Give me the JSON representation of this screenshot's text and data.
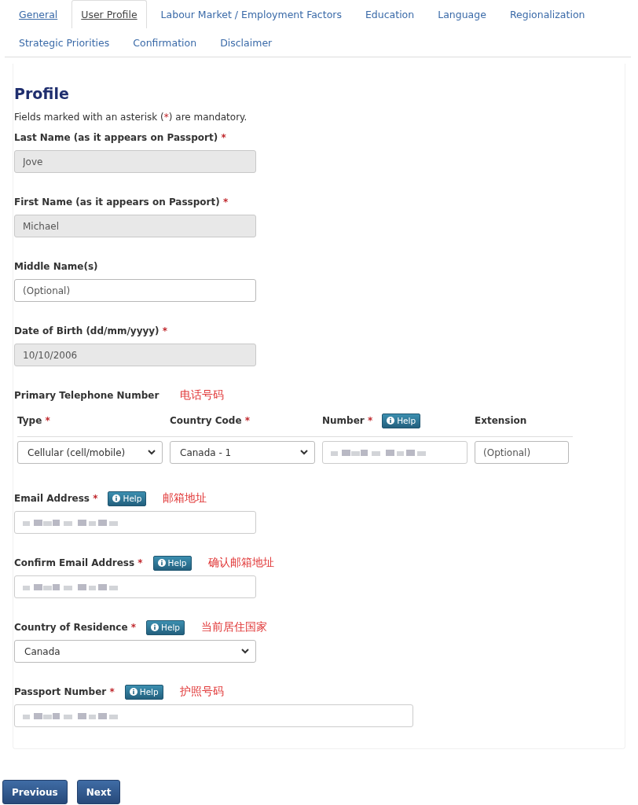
{
  "tabs": [
    {
      "label": "General",
      "selected": false,
      "visited": true
    },
    {
      "label": "User Profile",
      "selected": true,
      "visited": true
    },
    {
      "label": "Labour Market / Employment Factors",
      "selected": false,
      "visited": false
    },
    {
      "label": "Education",
      "selected": false,
      "visited": false
    },
    {
      "label": "Language",
      "selected": false,
      "visited": false
    },
    {
      "label": "Regionalization",
      "selected": false,
      "visited": false
    },
    {
      "label": "Strategic Priorities",
      "selected": false,
      "visited": false
    },
    {
      "label": "Confirmation",
      "selected": false,
      "visited": false
    },
    {
      "label": "Disclaimer",
      "selected": false,
      "visited": false
    }
  ],
  "form": {
    "title": "Profile",
    "intro": {
      "before": "Fields marked with an asterisk (",
      "mark": "*",
      "after": ") are mandatory."
    },
    "fields": [
      {
        "kind": "text",
        "label": "Last Name (as it appears on Passport)",
        "mark": "*",
        "value": "Jove",
        "disabled": true
      },
      {
        "kind": "text",
        "label": "First Name (as it appears on Passport)",
        "mark": "*",
        "value": "Michael",
        "disabled": true
      },
      {
        "kind": "text",
        "label": "Middle Name(s)",
        "placeholder": "(Optional)",
        "disabled": false
      },
      {
        "kind": "text",
        "label": "Date of Birth (dd/mm/yyyy)",
        "mark": "*",
        "value": "10/10/2006",
        "disabled": true
      },
      {
        "kind": "phone",
        "label": "Primary Telephone Number",
        "note": "电话号码",
        "columns": [
          {
            "label": "Type",
            "mark": "*",
            "control": {
              "kind": "select",
              "value": "Cellular (cell/mobile)"
            }
          },
          {
            "label": "Country Code",
            "mark": "*",
            "control": {
              "kind": "select",
              "value": "Canada - 1"
            }
          },
          {
            "label": "Number",
            "mark": "*",
            "help": "Help",
            "control": {
              "kind": "text",
              "blurred": true
            }
          },
          {
            "label": "Extension",
            "control": {
              "kind": "text",
              "placeholder": "(Optional)",
              "narrow": true
            }
          }
        ]
      },
      {
        "kind": "text",
        "label": "Email Address",
        "mark": "*",
        "help": "Help",
        "note": "邮箱地址",
        "blurred": true,
        "disabled": false
      },
      {
        "kind": "text",
        "label": "Confirm Email Address",
        "mark": "*",
        "help": "Help",
        "note": "确认邮箱地址",
        "blurred": true,
        "disabled": false
      },
      {
        "kind": "select",
        "label": "Country of Residence",
        "mark": "*",
        "help": "Help",
        "note": "当前居住国家",
        "value": "Canada"
      },
      {
        "kind": "text",
        "label": "Passport Number",
        "mark": "*",
        "help": "Help",
        "note": "护照号码",
        "blurred": true,
        "wide": true,
        "disabled": false
      }
    ]
  },
  "buttons": [
    "Previous",
    "Next"
  ]
}
